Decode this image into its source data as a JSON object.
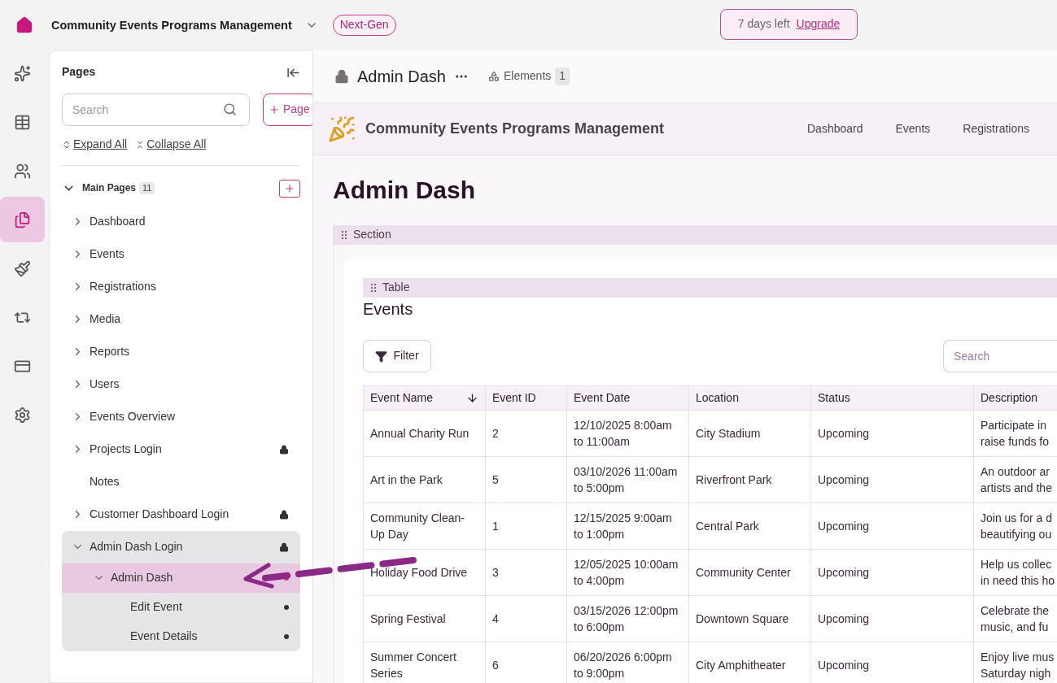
{
  "top_bar": {
    "app_title": "Community Events Programs Management",
    "badge": "Next-Gen",
    "trial": {
      "text": "7 days left",
      "link": "Upgrade"
    }
  },
  "rail": [
    {
      "kind": "ai",
      "selected": false
    },
    {
      "kind": "data",
      "selected": false
    },
    {
      "kind": "users",
      "selected": false
    },
    {
      "kind": "pages",
      "selected": true
    },
    {
      "kind": "design",
      "selected": false
    },
    {
      "kind": "logic",
      "selected": false
    },
    {
      "kind": "billing",
      "selected": false
    },
    {
      "kind": "settings",
      "selected": false
    }
  ],
  "pages_panel": {
    "title": "Pages",
    "search": {
      "placeholder": "Search"
    },
    "add_button": "Page",
    "expand_all": "Expand All",
    "collapse_all": "Collapse All",
    "groups": [
      {
        "label": "Main Pages",
        "count": "11",
        "expanded": true,
        "items": [
          {
            "label": "Dashboard",
            "kind": "folder",
            "expanded": false,
            "locked": false,
            "dot": false,
            "selected": false
          },
          {
            "label": "Events",
            "kind": "folder",
            "expanded": false,
            "locked": false,
            "dot": false,
            "selected": false
          },
          {
            "label": "Registrations",
            "kind": "folder",
            "expanded": false,
            "locked": false,
            "dot": false,
            "selected": false
          },
          {
            "label": "Media",
            "kind": "folder",
            "expanded": false,
            "locked": false,
            "dot": false,
            "selected": false
          },
          {
            "label": "Reports",
            "kind": "folder",
            "expanded": false,
            "locked": false,
            "dot": false,
            "selected": false
          },
          {
            "label": "Users",
            "kind": "folder",
            "expanded": false,
            "locked": false,
            "dot": false,
            "selected": false
          },
          {
            "label": "Events Overview",
            "kind": "folder",
            "expanded": false,
            "locked": false,
            "dot": false,
            "selected": false
          },
          {
            "label": "Projects Login",
            "kind": "folder",
            "expanded": false,
            "locked": true,
            "dot": false,
            "selected": false
          },
          {
            "label": "Notes",
            "kind": "page",
            "expanded": false,
            "locked": false,
            "dot": false,
            "selected": false
          },
          {
            "label": "Customer Dashboard Login",
            "kind": "folder",
            "expanded": false,
            "locked": true,
            "dot": false,
            "selected": false
          },
          {
            "label": "Admin Dash Login",
            "kind": "folder",
            "expanded": true,
            "locked": true,
            "dot": false,
            "selected": false,
            "children": [
              {
                "label": "Admin Dash",
                "kind": "folder",
                "expanded": true,
                "locked": false,
                "dot": true,
                "selected": true,
                "children": [
                  {
                    "label": "Edit Event",
                    "kind": "page",
                    "expanded": false,
                    "locked": false,
                    "dot": true,
                    "selected": false
                  },
                  {
                    "label": "Event Details",
                    "kind": "page",
                    "expanded": false,
                    "locked": false,
                    "dot": true,
                    "selected": false
                  }
                ]
              }
            ]
          }
        ]
      }
    ]
  },
  "editor": {
    "page_title": "Admin Dash",
    "elements_label": "Elements",
    "elements_count": "1"
  },
  "preview": {
    "app_name": "Community Events Programs Management",
    "nav": [
      "Dashboard",
      "Events",
      "Registrations"
    ],
    "heading": "Admin Dash",
    "section_label": "Section",
    "table_label": "Table",
    "table": {
      "title": "Events",
      "filter_button": "Filter",
      "search": {
        "placeholder": "Search"
      },
      "columns": [
        {
          "label": "Event Name",
          "sorted": true
        },
        {
          "label": "Event ID",
          "sorted": false
        },
        {
          "label": "Event Date",
          "sorted": false
        },
        {
          "label": "Location",
          "sorted": false
        },
        {
          "label": "Status",
          "sorted": false
        },
        {
          "label": "Description",
          "sorted": false
        }
      ],
      "rows": [
        [
          "Annual Charity Run",
          "2",
          "12/10/2025 8:00am to 11:00am",
          "City Stadium",
          "Upcoming",
          "Participate in\nraise funds fo"
        ],
        [
          "Art in the Park",
          "5",
          "03/10/2026 11:00am to 5:00pm",
          "Riverfront Park",
          "Upcoming",
          "An outdoor ar\nartists and the"
        ],
        [
          "Community Clean-Up Day",
          "1",
          "12/15/2025 9:00am to 1:00pm",
          "Central Park",
          "Upcoming",
          "Join us for a d\nbeautifying ou"
        ],
        [
          "Holiday Food Drive",
          "3",
          "12/05/2025 10:00am to 4:00pm",
          "Community Center",
          "Upcoming",
          "Help us collec\nin need this ho"
        ],
        [
          "Spring Festival",
          "4",
          "03/15/2026 12:00pm to 6:00pm",
          "Downtown Square",
          "Upcoming",
          "Celebrate the\nmusic, and fu"
        ],
        [
          "Summer Concert Series",
          "6",
          "06/20/2026 6:00pm to 9:00pm",
          "City Amphitheater",
          "Upcoming",
          "Enjoy live mus\nSaturday nigh"
        ]
      ]
    }
  },
  "annotation": {
    "kind": "dashed-arrow"
  }
}
